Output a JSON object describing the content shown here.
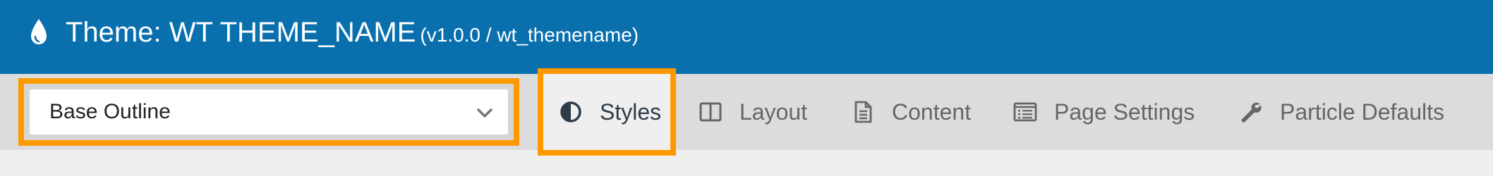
{
  "header": {
    "icon": "water-drop-icon",
    "title": "Theme: WT THEME_NAME",
    "version": "(v1.0.0 / wt_themename)"
  },
  "toolbar": {
    "outline_select": {
      "value": "Base Outline",
      "icon": "chevron-down-icon"
    },
    "tabs": [
      {
        "label": "Styles",
        "icon": "contrast-icon",
        "active": true
      },
      {
        "label": "Layout",
        "icon": "columns-icon",
        "active": false
      },
      {
        "label": "Content",
        "icon": "document-icon",
        "active": false
      },
      {
        "label": "Page Settings",
        "icon": "list-window-icon",
        "active": false
      },
      {
        "label": "Particle Defaults",
        "icon": "wrench-icon",
        "active": false
      }
    ]
  },
  "colors": {
    "header_bg": "#0a70ad",
    "toolbar_bg": "#dcdcdc",
    "highlight": "#ff9900",
    "active_text": "#2f3b49",
    "inactive_text": "#666666"
  }
}
